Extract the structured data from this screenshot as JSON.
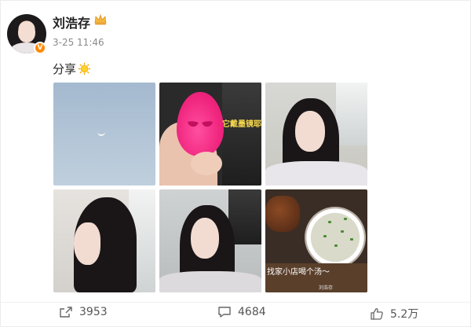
{
  "post": {
    "author": "刘浩存",
    "timestamp": "3-25 11:46",
    "text": "分享",
    "verified_badge": "V",
    "emoji": "sun-emoji",
    "member_icon": "crown-icon"
  },
  "photos": {
    "p2_caption": "它戴墨镜耶",
    "p6_caption": "找家小店喝个汤～",
    "p6_watermark": "刘浩存"
  },
  "actions": {
    "share_count": "3953",
    "comment_count": "4684",
    "like_count": "5.2万"
  },
  "colors": {
    "accent": "#ff8a00",
    "text": "#222222",
    "muted": "#8a8a8a"
  }
}
